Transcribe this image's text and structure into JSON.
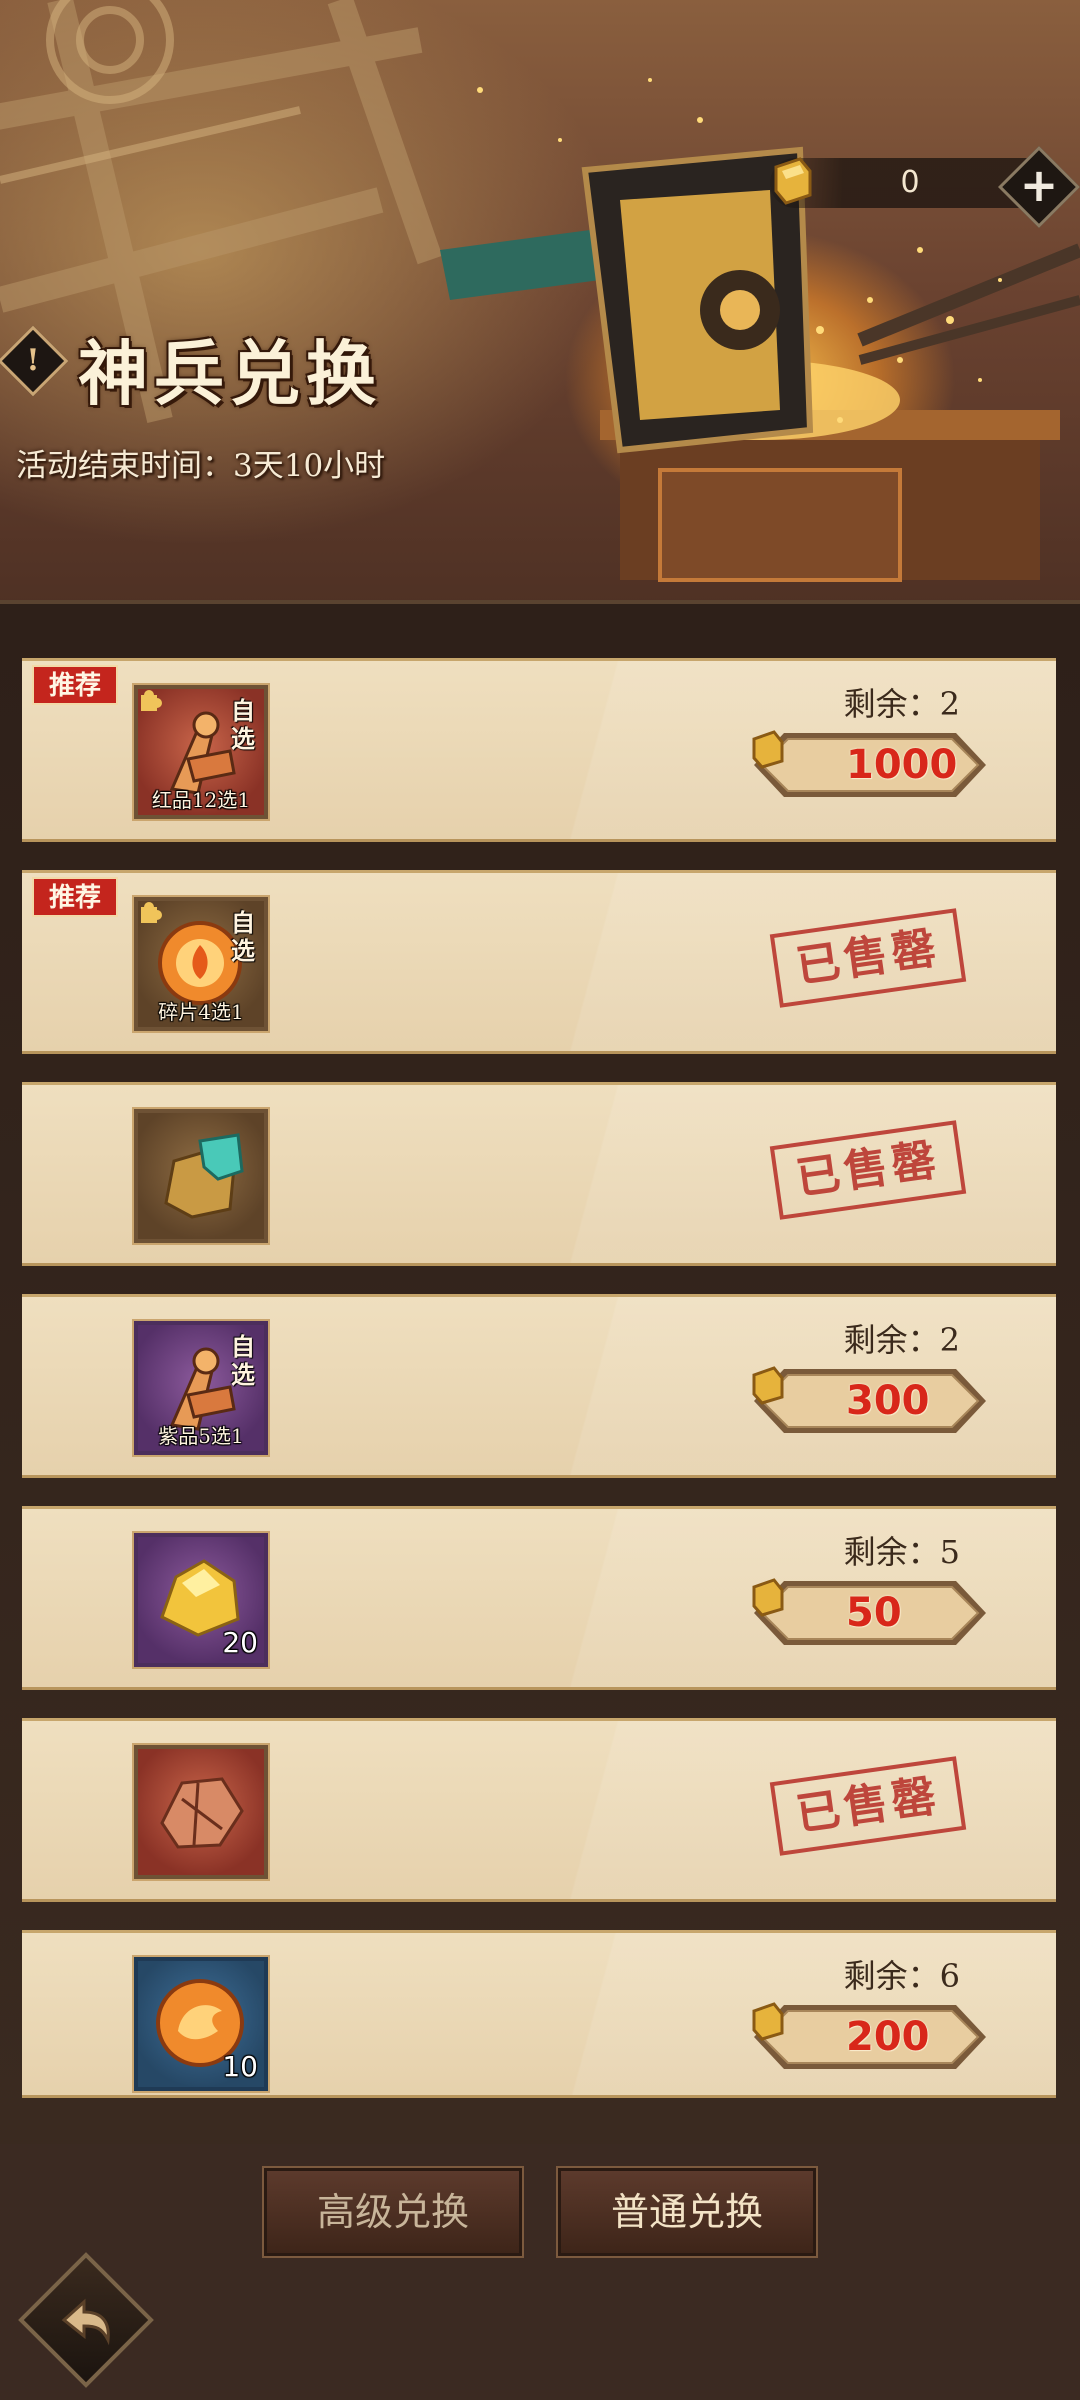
{
  "header": {
    "currency_value": "0",
    "title": "神兵兑换",
    "title_icon": "!",
    "end_time": "活动结束时间：3天10小时"
  },
  "items": [
    {
      "badge": "推荐",
      "choose": "自选",
      "caption": "红品12选1",
      "icon": "red-weapon-chest-icon",
      "remain": "剩余：2",
      "price": "1000",
      "sold_out": null
    },
    {
      "badge": "推荐",
      "choose": "自选",
      "caption": "碎片4选1",
      "icon": "fire-orb-fragment-icon",
      "remain": null,
      "price": null,
      "sold_out": "已售罄"
    },
    {
      "badge": null,
      "choose": null,
      "caption": null,
      "icon": "jade-ore-icon",
      "remain": null,
      "price": null,
      "sold_out": "已售罄"
    },
    {
      "badge": null,
      "choose": "自选",
      "caption": "紫品5选1",
      "icon": "purple-weapon-chest-icon",
      "remain": "剩余：2",
      "price": "300",
      "sold_out": null
    },
    {
      "badge": null,
      "choose": null,
      "caption": null,
      "qty": "20",
      "icon": "gold-ore-icon",
      "remain": "剩余：5",
      "price": "50",
      "sold_out": null
    },
    {
      "badge": null,
      "choose": null,
      "caption": null,
      "icon": "copper-ore-icon",
      "remain": null,
      "price": null,
      "sold_out": "已售罄"
    },
    {
      "badge": null,
      "choose": null,
      "caption": null,
      "qty": "10",
      "icon": "dragon-orb-icon",
      "remain": "剩余：6",
      "price": "200",
      "sold_out": null
    }
  ],
  "tabs": {
    "advanced": "高级兑换",
    "normal": "普通兑换"
  },
  "colors": {
    "price_red": "#d8271a",
    "badge_red": "#c4251d",
    "row_bg": "#efdfbf"
  }
}
